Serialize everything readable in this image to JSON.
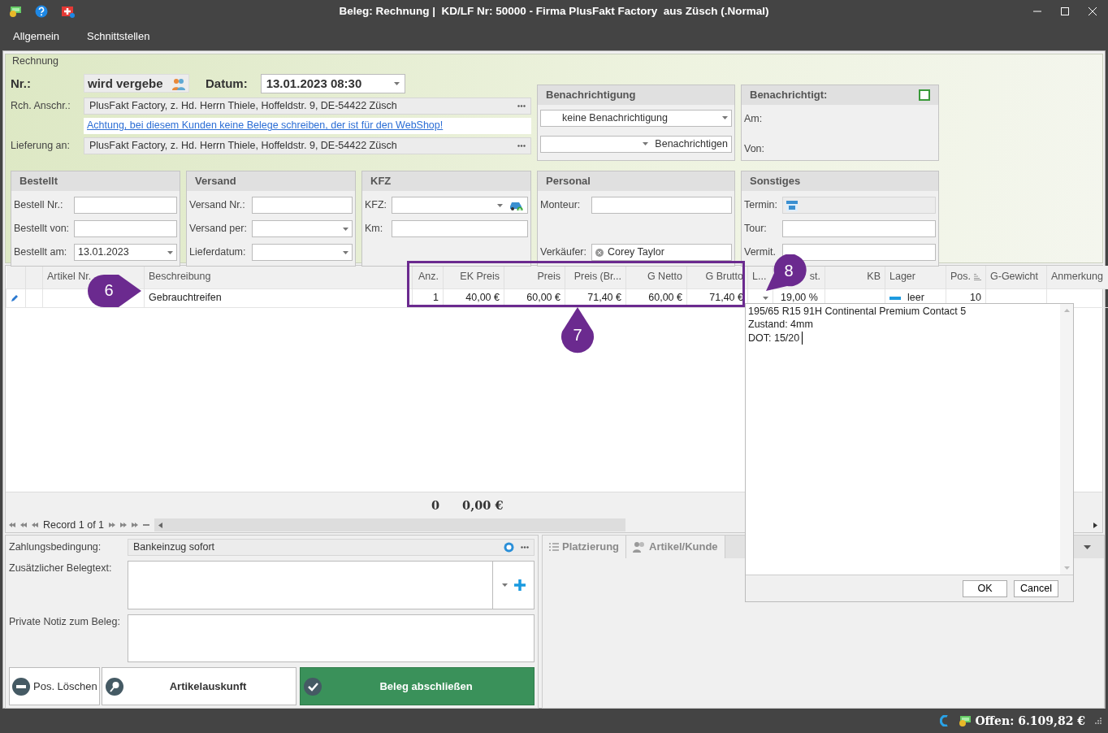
{
  "window": {
    "title": "Beleg: Rechnung |  KD/LF Nr: 50000 - Firma PlusFakt Factory  aus Züsch (.Normal)"
  },
  "menu": [
    {
      "label": "Allgemein"
    },
    {
      "label": "Schnittstellen"
    }
  ],
  "header": {
    "group_title": "Rechnung",
    "nr_label": "Nr.:",
    "nr_value": "wird vergebe",
    "datum_label": "Datum:",
    "datum_value": "13.01.2023 08:30",
    "rch_label": "Rch. Anschr.:",
    "rch_value": "PlusFakt Factory, z. Hd. Herrn Thiele, Hoffeldstr. 9, DE-54422 Züsch",
    "warning_link": "Achtung, bei diesem Kunden keine Belege schreiben, der ist für den WebShop!",
    "lieferung_label": "Lieferung an:",
    "lieferung_value": "PlusFakt Factory, z. Hd. Herrn Thiele, Hoffeldstr. 9, DE-54422 Züsch"
  },
  "notification": {
    "title": "Benachrichtigung",
    "select_value": "keine Benachrichtigung",
    "button": "Benachrichtigen"
  },
  "notified": {
    "title": "Benachrichtigt:",
    "checked": false,
    "fields": [
      {
        "label": "Am:"
      },
      {
        "label": "Von:"
      }
    ]
  },
  "groups": [
    {
      "title": "Bestellt",
      "fields": [
        {
          "label": "Bestell Nr.:",
          "kind": "text"
        },
        {
          "label": "Bestellt von:",
          "kind": "text"
        },
        {
          "label": "Bestellt am:",
          "kind": "select",
          "value": "13.01.2023"
        }
      ]
    },
    {
      "title": "Versand",
      "fields": [
        {
          "label": "Versand Nr.:",
          "kind": "text"
        },
        {
          "label": "Versand per:",
          "kind": "select"
        },
        {
          "label": "Lieferdatum:",
          "kind": "select"
        }
      ]
    },
    {
      "title": "KFZ",
      "fields": [
        {
          "label": "KFZ:",
          "kind": "car"
        },
        {
          "label": "Km:",
          "kind": "text"
        }
      ]
    },
    {
      "title": "Personal",
      "fields": [
        {
          "label": "Monteur:",
          "kind": "text"
        },
        {
          "label": "Verkäufer:",
          "kind": "person",
          "value": "Corey Taylor"
        }
      ]
    },
    {
      "title": "Sonstiges",
      "fields": [
        {
          "label": "Termin:",
          "kind": "calendar"
        },
        {
          "label": "Tour:",
          "kind": "text"
        },
        {
          "label": "Vermit.",
          "kind": "text"
        }
      ]
    }
  ],
  "table": {
    "columns": [
      {
        "label": "Artikel Nr.",
        "kind": "text"
      },
      {
        "label": "Beschreibung",
        "kind": "text"
      },
      {
        "label": "Anz.",
        "kind": "number"
      },
      {
        "label": "EK Preis",
        "kind": "number"
      },
      {
        "label": "Preis",
        "kind": "number"
      },
      {
        "label": "Preis (Br...",
        "kind": "number"
      },
      {
        "label": "G Netto",
        "kind": "number"
      },
      {
        "label": "G Brutto",
        "kind": "number"
      },
      {
        "label": "L...",
        "kind": "dropdown"
      },
      {
        "label": "st.",
        "kind": "percent"
      },
      {
        "label": "KB",
        "kind": "number"
      },
      {
        "label": "Lager",
        "kind": "status"
      },
      {
        "label": "Pos.",
        "kind": "sorted"
      },
      {
        "label": "G-Gewicht",
        "kind": "text"
      },
      {
        "label": "Anmerkung",
        "kind": "text"
      }
    ],
    "rows": [
      {
        "editing": true,
        "cells": [
          {},
          {
            "text": "Gebrauchtreifen"
          },
          {
            "text": "1"
          },
          {
            "text": "40,00 €"
          },
          {
            "text": "60,00 €"
          },
          {
            "text": "71,40 €"
          },
          {
            "text": "60,00 €"
          },
          {
            "text": "71,40 €"
          },
          {},
          {
            "text": "19,00 %"
          },
          {},
          {
            "text": "leer",
            "color": "#1e9be0"
          },
          {
            "text": "10"
          },
          {},
          {}
        ]
      }
    ],
    "totals": [
      "0",
      "0,00 €"
    ],
    "record": "Record 1 of 1"
  },
  "memo": {
    "lines": [
      "195/65 R15 91H Continental Premium Contact 5",
      "Zustand: 4mm",
      "DOT: 15/20"
    ],
    "buttons": [
      "OK",
      "Cancel"
    ]
  },
  "payment": {
    "label": "Zahlungsbedingung:",
    "value": "Bankeinzug sofort"
  },
  "belegtext": {
    "label": "Zusätzlicher Belegtext:"
  },
  "notiz": {
    "label": "Private Notiz zum Beleg:"
  },
  "actions": [
    {
      "label": "Pos. Löschen",
      "kind": "delete"
    },
    {
      "label": "Artikelauskunft",
      "kind": "search"
    },
    {
      "label": "Beleg abschließen",
      "kind": "primary"
    }
  ],
  "tabs": [
    {
      "label": "Platzierung",
      "selected": false
    },
    {
      "label": "Artikel/Kunde",
      "selected": false
    }
  ],
  "callouts": [
    {
      "number": "6"
    },
    {
      "number": "7"
    },
    {
      "number": "8"
    }
  ],
  "status_bar": {
    "offen": "Offen: 6.109,82 €"
  }
}
